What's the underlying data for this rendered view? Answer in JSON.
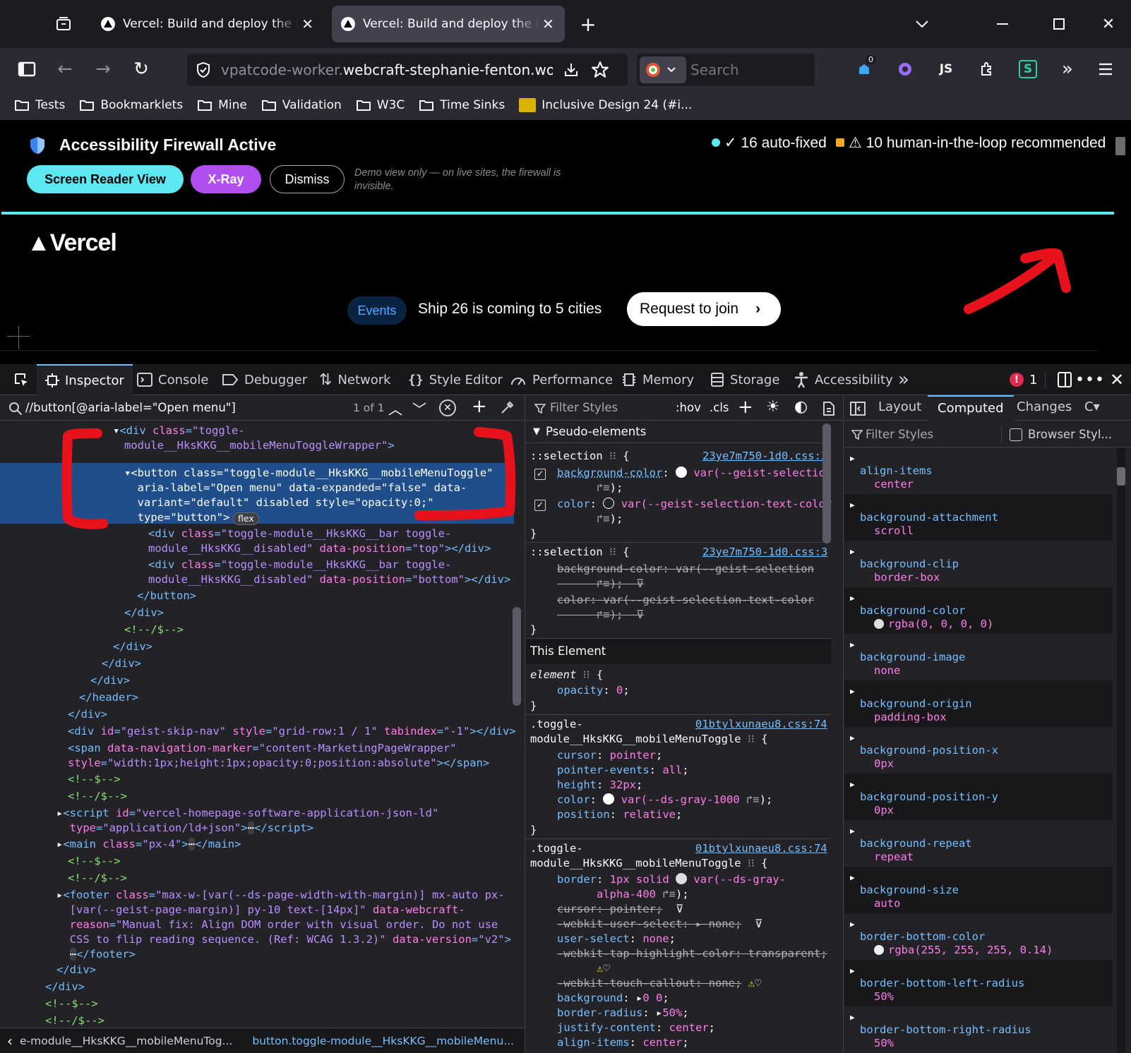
{
  "browser": {
    "tabs": [
      {
        "title": "Vercel: Build and deploy the best web experiences with the Frontend Cloud"
      },
      {
        "title": "Vercel: Build and deploy the best web experiences with the Frontend Cloud"
      }
    ],
    "url_prefix": "vpatcode-worker.",
    "url_domain": "webcraft-stephanie-fenton.workers",
    "search_placeholder": "Search",
    "badge_count": "0",
    "ext_js_label": "JS",
    "ext_s_label": "S",
    "bookmarks": [
      "Tests",
      "Bookmarklets",
      "Mine",
      "Validation",
      "W3C",
      "Time Sinks",
      "Inclusive Design 24 (#i..."
    ]
  },
  "firewall": {
    "title": "Accessibility Firewall Active",
    "auto_fixed": "✓ 16 auto-fixed",
    "human_loop": "⚠ 10 human-in-the-loop recommended",
    "buttons": [
      "Screen Reader View",
      "X-Ray",
      "Dismiss"
    ],
    "note": "Demo view only — on live sites, the firewall is invisible.",
    "accent_color": "#5ce8f0",
    "xray_color": "#b14ef0",
    "dot_cyan": "#5ce8f0",
    "dot_orange": "#f5a623"
  },
  "vercel": {
    "logo": "▲Vercel",
    "events_badge": "Events",
    "banner_text": "Ship 26 is coming to 5 cities",
    "cta": "Request to join",
    "cta_arrow": "›"
  },
  "devtools": {
    "tabs": [
      "Inspector",
      "Console",
      "Debugger",
      "Network",
      "Style Editor",
      "Performance",
      "Memory",
      "Storage",
      "Accessibility"
    ],
    "error_count": "1",
    "search_query": "//button[@aria-label=\"Open menu\"]",
    "search_result": "1 of 1",
    "rules_filter": "Filter Styles",
    "hov": ":hov",
    "cls": ".cls",
    "side_tabs": [
      "Layout",
      "Computed",
      "Changes"
    ],
    "computed_filter": "Filter Styles",
    "browser_styles": "Browser Styl...",
    "breadcrumbs": [
      "e-module__HksKKG__mobileMenuTog...",
      "button.toggle-module__HksKKG__mobileMenu..."
    ],
    "flex_badge": "flex",
    "pseudo_header": "Pseudo-elements",
    "this_element": "This Element",
    "computed": [
      {
        "name": "align-items",
        "value": "center"
      },
      {
        "name": "background-attachment",
        "value": "scroll"
      },
      {
        "name": "background-clip",
        "value": "border-box"
      },
      {
        "name": "background-color",
        "value": "rgba(0, 0, 0, 0)"
      },
      {
        "name": "background-image",
        "value": "none"
      },
      {
        "name": "background-origin",
        "value": "padding-box"
      },
      {
        "name": "background-position-x",
        "value": "0px"
      },
      {
        "name": "background-position-y",
        "value": "0px"
      },
      {
        "name": "background-repeat",
        "value": "repeat"
      },
      {
        "name": "background-size",
        "value": "auto"
      },
      {
        "name": "border-bottom-color",
        "value": "rgba(255, 255, 255, 0.14)"
      },
      {
        "name": "border-bottom-left-radius",
        "value": "50%"
      },
      {
        "name": "border-bottom-right-radius",
        "value": "50%"
      }
    ],
    "highlight_color": "#204e8a",
    "annotation_color": "#e8121c"
  }
}
